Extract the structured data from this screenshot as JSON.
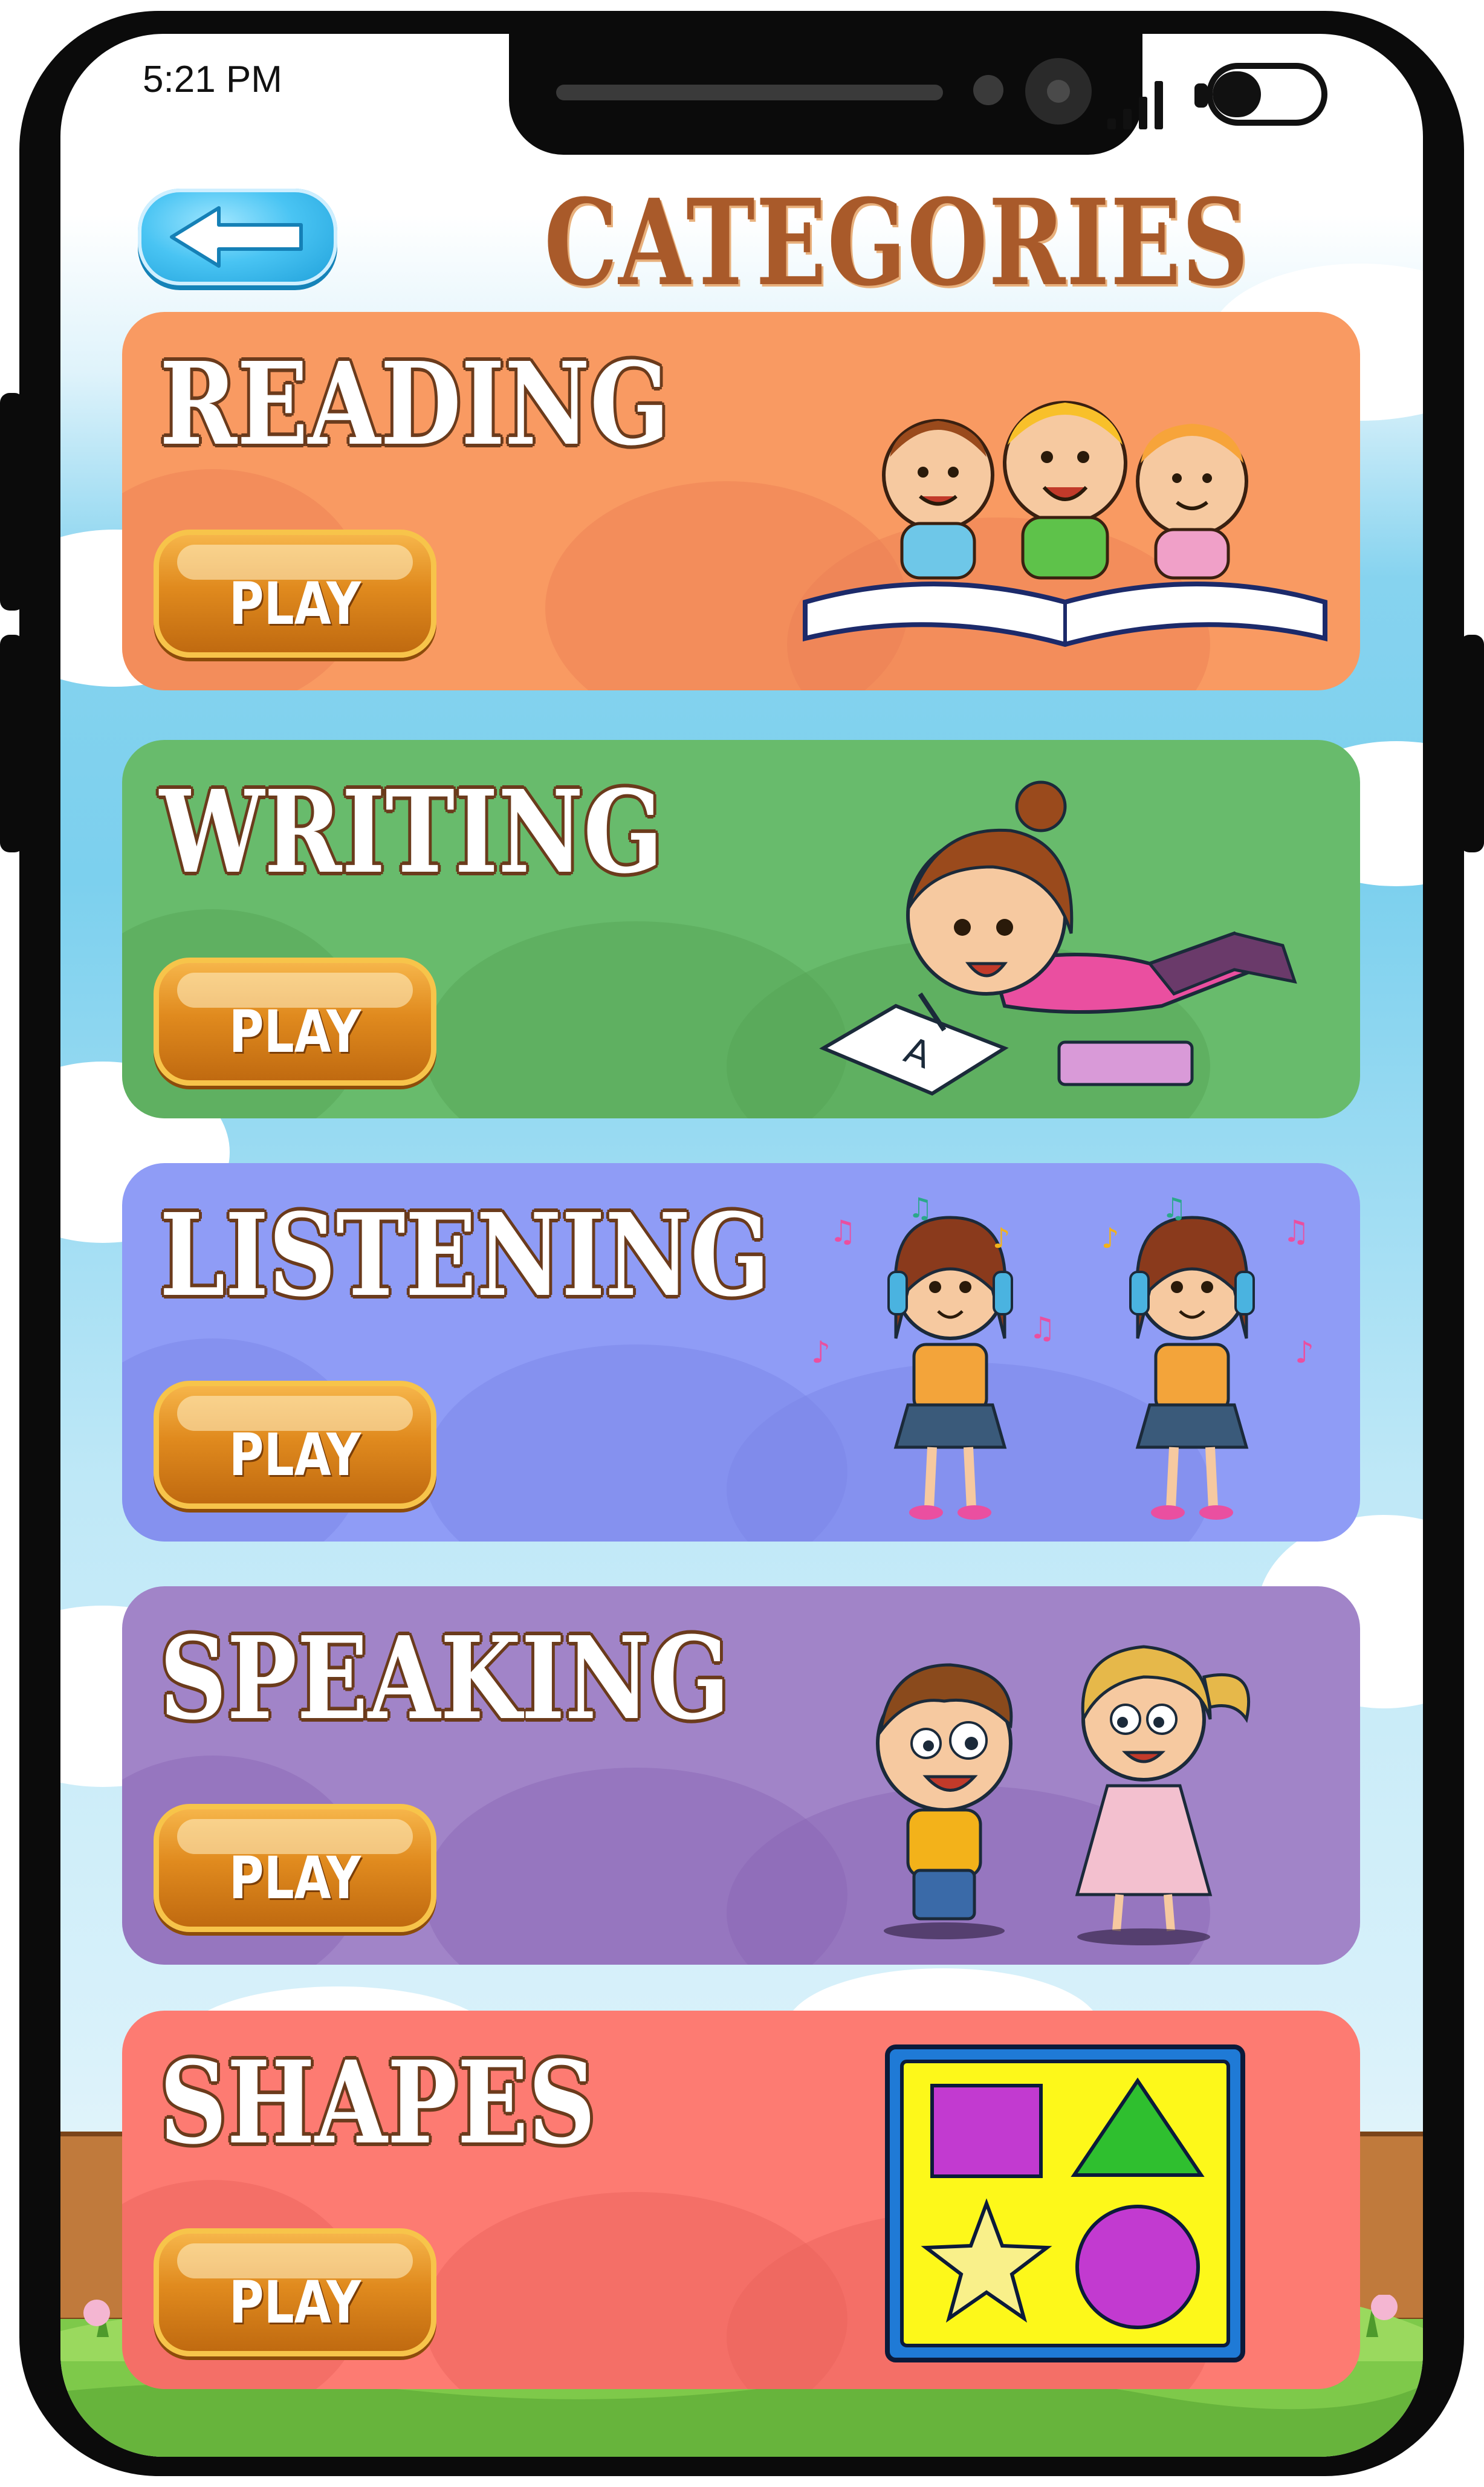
{
  "status_bar": {
    "time": "5:21 PM"
  },
  "header": {
    "title": "CATEGORIES"
  },
  "categories": [
    {
      "title": "READING",
      "play_label": "PLAY",
      "color": "#f99a62"
    },
    {
      "title": "WRITING",
      "play_label": "PLAY",
      "color": "#68bb6c"
    },
    {
      "title": "LISTENING",
      "play_label": "PLAY",
      "color": "#8f9cf6"
    },
    {
      "title": "SPEAKING",
      "play_label": "PLAY",
      "color": "#a184c8"
    },
    {
      "title": "SHAPES",
      "play_label": "PLAY",
      "color": "#fd7b72"
    }
  ],
  "icons": {
    "back": "left-arrow-icon",
    "signal": "signal-bars-icon",
    "battery": "battery-icon"
  }
}
